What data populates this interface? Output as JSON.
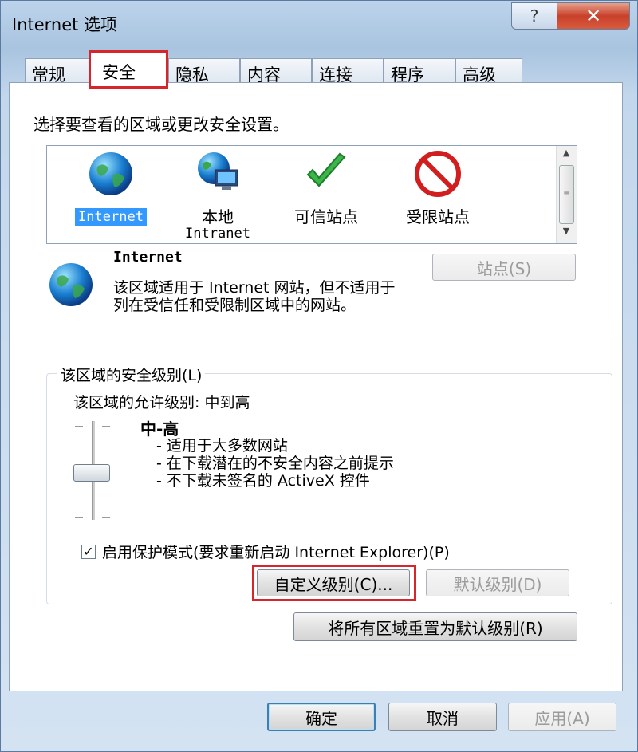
{
  "window": {
    "title": "Internet 选项",
    "help_glyph": "?",
    "close_glyph": "✕"
  },
  "tabs": [
    {
      "label": "常规"
    },
    {
      "label": "安全",
      "active": true
    },
    {
      "label": "隐私"
    },
    {
      "label": "内容"
    },
    {
      "label": "连接"
    },
    {
      "label": "程序"
    },
    {
      "label": "高级"
    }
  ],
  "security": {
    "zone_prompt": "选择要查看的区域或更改安全设置。",
    "zones": [
      {
        "label": "Internet",
        "sub": "",
        "icon": "globe-icon",
        "selected": true
      },
      {
        "label": "本地",
        "sub": "Intranet",
        "icon": "local-intranet-icon"
      },
      {
        "label": "可信站点",
        "sub": "",
        "icon": "checkmark-icon"
      },
      {
        "label": "受限站点",
        "sub": "",
        "icon": "restricted-icon"
      }
    ],
    "selected_zone": {
      "title": "Internet",
      "desc": "该区域适用于 Internet 网站，但不适用于列在受信任和受限制区域中的网站。",
      "sites_button": "站点(S)"
    },
    "level_group": {
      "legend": "该区域的安全级别(L)",
      "allowed": "该区域的允许级别: 中到高",
      "level_name": "中-高",
      "bullets": [
        "- 适用于大多数网站",
        "- 在下载潜在的不安全内容之前提示",
        "- 不下载未签名的 ActiveX 控件"
      ],
      "slider_level": "中-高",
      "protected_mode_label": "启用保护模式(要求重新启动 Internet Explorer)(P)",
      "protected_mode_checked": true,
      "custom_level_button": "自定义级别(C)...",
      "default_level_button": "默认级别(D)"
    },
    "reset_all_button": "将所有区域重置为默认级别(R)"
  },
  "footer": {
    "ok": "确定",
    "cancel": "取消",
    "apply": "应用(A)"
  },
  "colors": {
    "highlight_box": "#d6262c",
    "selection": "#3399ff",
    "close_button": "#c8402a"
  }
}
